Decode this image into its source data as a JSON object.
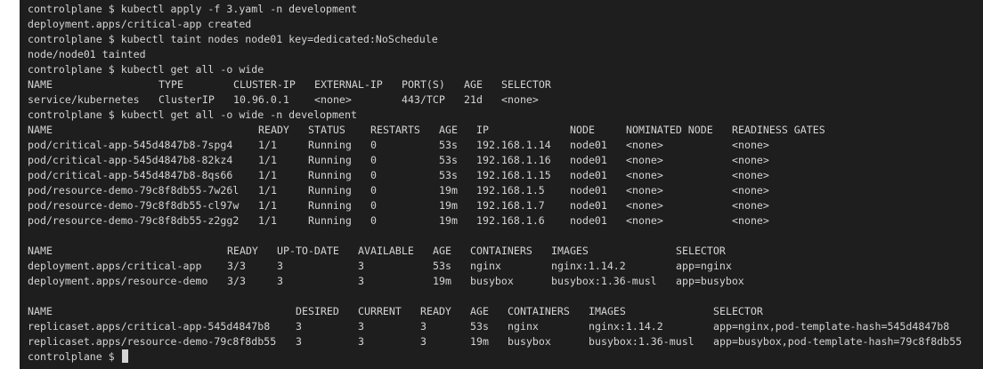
{
  "terminal": {
    "lines": [
      "controlplane $ kubectl apply -f 3.yaml -n development",
      "deployment.apps/critical-app created",
      "controlplane $ kubectl taint nodes node01 key=dedicated:NoSchedule",
      "node/node01 tainted",
      "controlplane $ kubectl get all -o wide"
    ],
    "services": {
      "headers": [
        "NAME",
        "TYPE",
        "CLUSTER-IP",
        "EXTERNAL-IP",
        "PORT(S)",
        "AGE",
        "SELECTOR"
      ],
      "rows": [
        [
          "service/kubernetes",
          "ClusterIP",
          "10.96.0.1",
          "<none>",
          "443/TCP",
          "21d",
          "<none>"
        ]
      ]
    },
    "command2": "controlplane $ kubectl get all -o wide -n development",
    "pods": {
      "headers": [
        "NAME",
        "READY",
        "STATUS",
        "RESTARTS",
        "AGE",
        "IP",
        "NODE",
        "NOMINATED NODE",
        "READINESS GATES"
      ],
      "rows": [
        [
          "pod/critical-app-545d4847b8-7spg4",
          "1/1",
          "Running",
          "0",
          "53s",
          "192.168.1.14",
          "node01",
          "<none>",
          "<none>"
        ],
        [
          "pod/critical-app-545d4847b8-82kz4",
          "1/1",
          "Running",
          "0",
          "53s",
          "192.168.1.16",
          "node01",
          "<none>",
          "<none>"
        ],
        [
          "pod/critical-app-545d4847b8-8qs66",
          "1/1",
          "Running",
          "0",
          "53s",
          "192.168.1.15",
          "node01",
          "<none>",
          "<none>"
        ],
        [
          "pod/resource-demo-79c8f8db55-7w26l",
          "1/1",
          "Running",
          "0",
          "19m",
          "192.168.1.5",
          "node01",
          "<none>",
          "<none>"
        ],
        [
          "pod/resource-demo-79c8f8db55-cl97w",
          "1/1",
          "Running",
          "0",
          "19m",
          "192.168.1.7",
          "node01",
          "<none>",
          "<none>"
        ],
        [
          "pod/resource-demo-79c8f8db55-z2gg2",
          "1/1",
          "Running",
          "0",
          "19m",
          "192.168.1.6",
          "node01",
          "<none>",
          "<none>"
        ]
      ]
    },
    "deployments": {
      "headers": [
        "NAME",
        "READY",
        "UP-TO-DATE",
        "AVAILABLE",
        "AGE",
        "CONTAINERS",
        "IMAGES",
        "SELECTOR"
      ],
      "rows": [
        [
          "deployment.apps/critical-app",
          "3/3",
          "3",
          "3",
          "53s",
          "nginx",
          "nginx:1.14.2",
          "app=nginx"
        ],
        [
          "deployment.apps/resource-demo",
          "3/3",
          "3",
          "3",
          "19m",
          "busybox",
          "busybox:1.36-musl",
          "app=busybox"
        ]
      ]
    },
    "replicasets": {
      "headers": [
        "NAME",
        "DESIRED",
        "CURRENT",
        "READY",
        "AGE",
        "CONTAINERS",
        "IMAGES",
        "SELECTOR"
      ],
      "rows": [
        [
          "replicaset.apps/critical-app-545d4847b8",
          "3",
          "3",
          "3",
          "53s",
          "nginx",
          "nginx:1.14.2",
          "app=nginx,pod-template-hash=545d4847b8"
        ],
        [
          "replicaset.apps/resource-demo-79c8f8db55",
          "3",
          "3",
          "3",
          "19m",
          "busybox",
          "busybox:1.36-musl",
          "app=busybox,pod-template-hash=79c8f8db55"
        ]
      ]
    },
    "prompt": "controlplane $"
  }
}
